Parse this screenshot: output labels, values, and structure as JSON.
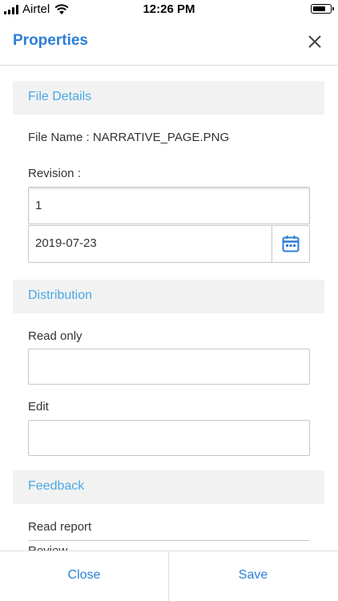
{
  "status_bar": {
    "carrier": "Airtel",
    "time": "12:26 PM"
  },
  "header": {
    "title": "Properties",
    "close_icon": "close-icon"
  },
  "sections": {
    "file_details": {
      "title": "File Details",
      "file_name": "File Name : NARRATIVE_PAGE.PNG",
      "revision_label": "Revision :",
      "revision_value": "1",
      "date_value": "2019-07-23",
      "calendar_icon": "calendar-icon"
    },
    "distribution": {
      "title": "Distribution",
      "read_only_label": "Read only",
      "read_only_value": "",
      "edit_label": "Edit",
      "edit_value": ""
    },
    "feedback": {
      "title": "Feedback",
      "read_report_label": "Read report",
      "review_label": "Review"
    }
  },
  "footer": {
    "close_label": "Close",
    "save_label": "Save"
  },
  "colors": {
    "accent": "#2c7fd6",
    "section_title": "#4aa8e6",
    "section_bg": "#f2f2f2"
  }
}
